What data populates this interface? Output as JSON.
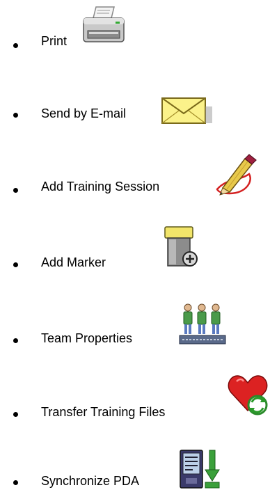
{
  "items": [
    {
      "label": "Print",
      "icon": "printer-icon"
    },
    {
      "label": "Send by E-mail",
      "icon": "envelope-icon"
    },
    {
      "label": "Add Training Session",
      "icon": "pencil-icon"
    },
    {
      "label": "Add Marker",
      "icon": "paint-roller-icon"
    },
    {
      "label": "Team Properties",
      "icon": "team-icon"
    },
    {
      "label": "Transfer Training Files",
      "icon": "heart-transfer-icon"
    },
    {
      "label": "Synchronize PDA",
      "icon": "pda-sync-icon"
    }
  ]
}
